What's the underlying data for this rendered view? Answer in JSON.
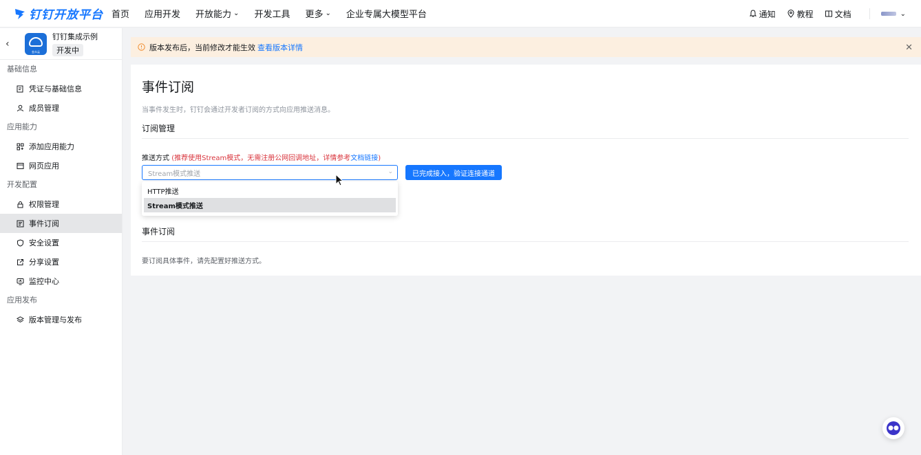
{
  "topnav": {
    "logo_text": "钉钉开放平台",
    "items": [
      {
        "label": "首页"
      },
      {
        "label": "应用开发"
      },
      {
        "label": "开放能力",
        "has_dropdown": true
      },
      {
        "label": "开发工具"
      },
      {
        "label": "更多",
        "has_dropdown": true
      },
      {
        "label": "企业专属大模型平台"
      }
    ],
    "right": {
      "notify": "通知",
      "tutorial": "教程",
      "docs": "文档"
    }
  },
  "sidebar": {
    "app_name": "钉钉集成示例",
    "app_status": "开发中",
    "app_logo_label": "金众云",
    "groups": [
      {
        "title": "基础信息",
        "items": [
          {
            "label": "凭证与基础信息",
            "icon": "credential-icon"
          },
          {
            "label": "成员管理",
            "icon": "user-icon"
          }
        ]
      },
      {
        "title": "应用能力",
        "items": [
          {
            "label": "添加应用能力",
            "icon": "grid-plus-icon"
          },
          {
            "label": "网页应用",
            "icon": "browser-icon"
          }
        ]
      },
      {
        "title": "开发配置",
        "items": [
          {
            "label": "权限管理",
            "icon": "lock-icon"
          },
          {
            "label": "事件订阅",
            "icon": "event-icon",
            "active": true
          },
          {
            "label": "安全设置",
            "icon": "shield-icon"
          },
          {
            "label": "分享设置",
            "icon": "share-icon"
          },
          {
            "label": "监控中心",
            "icon": "monitor-icon"
          }
        ]
      },
      {
        "title": "应用发布",
        "items": [
          {
            "label": "版本管理与发布",
            "icon": "layers-icon"
          }
        ]
      }
    ]
  },
  "banner": {
    "text": "版本发布后，当前修改才能生效",
    "link": "查看版本详情"
  },
  "main": {
    "title": "事件订阅",
    "description": "当事件发生时，钉钉会通过开发者订阅的方式向应用推送消息。",
    "subscription_section": "订阅管理",
    "push_label": "推送方式",
    "push_hint_open": "(",
    "push_hint": "推荐使用Stream模式，无需注册公网回调地址，详情参考",
    "push_hint_link": "文档链接",
    "push_hint_close": ")",
    "select_value": "Stream模式推送",
    "verify_button": "已完成接入，验证连接通道",
    "dropdown_options": [
      {
        "label": "HTTP推送",
        "selected": false
      },
      {
        "label": "Stream模式推送",
        "selected": true
      }
    ],
    "event_section": "事件订阅",
    "event_empty_tip": "要订阅具体事件，请先配置好推送方式。"
  },
  "colors": {
    "primary": "#1677ff",
    "banner_bg": "#fcefe0",
    "warn": "#f08b2c",
    "hint_red": "#d9363e"
  }
}
